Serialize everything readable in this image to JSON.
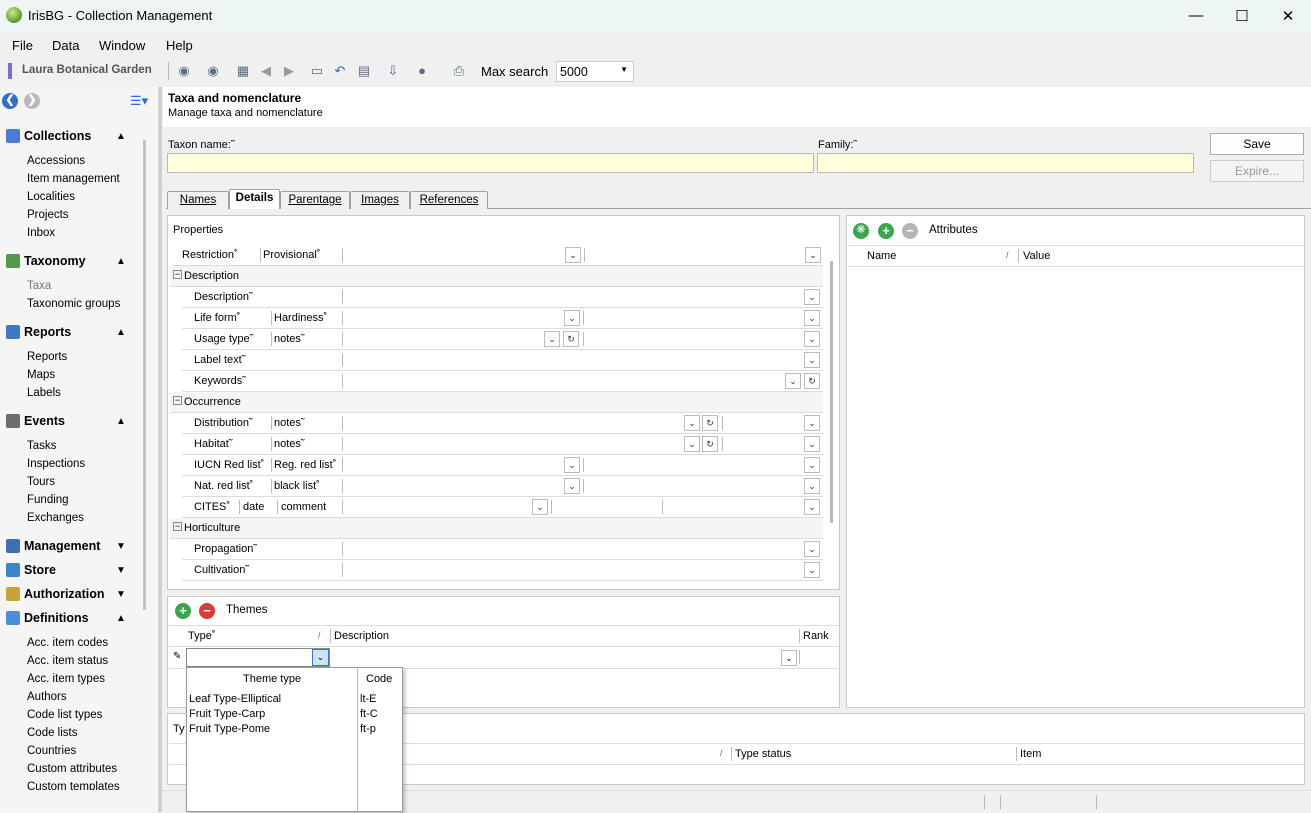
{
  "window": {
    "title": "IrisBG - Collection Management"
  },
  "menu": [
    "File",
    "Data",
    "Window",
    "Help"
  ],
  "toolbar": {
    "garden": "Laura Botanical Garden",
    "max_search_label": "Max search",
    "max_search_value": "5000"
  },
  "nav": {
    "collections": {
      "title": "Collections",
      "items": [
        "Accessions",
        "Item management",
        "Localities",
        "Projects",
        "Inbox"
      ]
    },
    "taxonomy": {
      "title": "Taxonomy",
      "items": [
        "Taxa",
        "Taxonomic groups"
      ]
    },
    "reports": {
      "title": "Reports",
      "items": [
        "Reports",
        "Maps",
        "Labels"
      ]
    },
    "events": {
      "title": "Events",
      "items": [
        "Tasks",
        "Inspections",
        "Tours",
        "Funding",
        "Exchanges"
      ]
    },
    "management": {
      "title": "Management"
    },
    "store": {
      "title": "Store"
    },
    "authorization": {
      "title": "Authorization"
    },
    "definitions": {
      "title": "Definitions",
      "items": [
        "Acc. item codes",
        "Acc. item status",
        "Acc. item types",
        "Authors",
        "Code list types",
        "Code lists",
        "Countries",
        "Custom attributes",
        "Custom templates"
      ]
    }
  },
  "header": {
    "title": "Taxa and nomenclature",
    "subtitle": "Manage taxa and nomenclature"
  },
  "form": {
    "taxon_label": "Taxon name:˜",
    "family_label": "Family:˜",
    "save": "Save",
    "expire": "Expire..."
  },
  "tabs": [
    "Names",
    "Details",
    "Parentage",
    "Images",
    "References"
  ],
  "properties": {
    "title": "Properties",
    "restriction": "Restriction˚",
    "provisional": "Provisional˚",
    "description_section": "Description",
    "description": "Description˜",
    "life_form": "Life form˚",
    "hardiness": "Hardiness˚",
    "usage_type": "Usage type˜",
    "usage_notes": "notes˜",
    "label_text": "Label text˜",
    "keywords": "Keywords˜",
    "occurrence_section": "Occurrence",
    "distribution": "Distribution˜",
    "distribution_notes": "notes˜",
    "habitat": "Habitat˜",
    "habitat_notes": "notes˜",
    "iucn": "IUCN Red list˚",
    "reg_red": "Reg. red list˚",
    "nat_red": "Nat. red list˚",
    "black_list": "black list˚",
    "cites": "CITES˚",
    "date": "date",
    "comment": "comment",
    "horticulture_section": "Horticulture",
    "propagation": "Propagation˜",
    "cultivation": "Cultivation˜"
  },
  "attributes": {
    "title": "Attributes",
    "col_name": "Name",
    "col_value": "Value"
  },
  "themes": {
    "title": "Themes",
    "col_type": "Type˚",
    "col_description": "Description",
    "col_rank": "Rank"
  },
  "popup": {
    "col_theme": "Theme type",
    "col_code": "Code",
    "rows": [
      {
        "type": "Leaf Type-Elliptical",
        "code": "lt-E"
      },
      {
        "type": "Fruit Type-Carp",
        "code": "ft-C"
      },
      {
        "type": "Fruit Type-Pome",
        "code": "ft-p"
      }
    ]
  },
  "bottom": {
    "col_ty": "Ty",
    "col_type_status": "Type status",
    "col_item": "Item"
  },
  "colors": {
    "green": "#3aa64a",
    "red": "#d93a3a",
    "yellow_input": "#ffffdc"
  }
}
